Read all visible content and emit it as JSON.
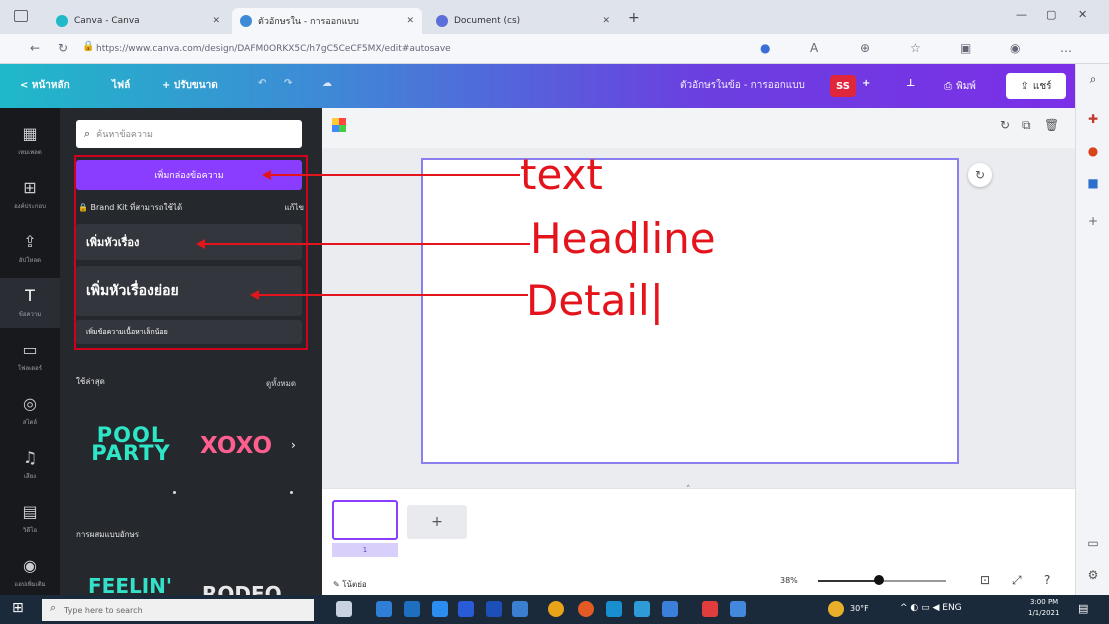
{
  "browser": {
    "tabs": [
      {
        "label": "Canva - Canva",
        "active": false
      },
      {
        "label": "ตัวอักษรใน - การออกแบบ",
        "active": true
      },
      {
        "label": "Document (cs)",
        "active": false
      }
    ],
    "new_tab": "+",
    "url": "https://www.canva.com/design/DAFM0ORKX5C/h7gC5CeCF5MX/edit#autosave"
  },
  "topbar": {
    "home": "< หน้าหลัก",
    "file": "ไฟล์",
    "resize": "+ ปรับขนาด",
    "design_title": "ตัวอักษรในข้อ - การออกแบบ",
    "avatar": "SS",
    "print": "พิมพ์",
    "share": "แชร์"
  },
  "rail": [
    {
      "icon": "▦",
      "label": "เทมเพลต"
    },
    {
      "icon": "⊞",
      "label": "องค์ประกอบ"
    },
    {
      "icon": "⇪",
      "label": "อัปโหลด"
    },
    {
      "icon": "T",
      "label": "ข้อความ"
    },
    {
      "icon": "▭",
      "label": "โฟลเดอร์"
    },
    {
      "icon": "◎",
      "label": "สไตล์"
    },
    {
      "icon": "♫",
      "label": "เสียง"
    },
    {
      "icon": "▤",
      "label": "วิดีโอ"
    },
    {
      "icon": "◉",
      "label": "แอปเพิ่มเติม"
    }
  ],
  "panel": {
    "search_placeholder": "ค้นหาข้อความ",
    "add_textbox": "เพิ่มกล่องข้อความ",
    "brand_kit": "Brand Kit ที่สามารถใช้ได้",
    "brand_edit": "แก้ไข",
    "heading": "เพิ่มหัวเรื่อง",
    "subheading": "เพิ่มหัวเรื่องย่อย",
    "body": "เพิ่มข้อความเนื้อหาเล็กน้อย",
    "section1": "ใช้ล่าสุด",
    "section1_link": "ดูทั้งหมด",
    "section2": "การผสมแบบอักษร",
    "sample1": "POOL PARTY",
    "sample2": "XOXO",
    "sample3": "FEELIN'",
    "sample4": "RODEO"
  },
  "annotations": {
    "text": "text",
    "headline": "Headline",
    "detail": "Detail|"
  },
  "footer": {
    "notes": "โน้ตย่อ",
    "zoom": "38%",
    "zoom_fraction": 0.38,
    "page_number": "1"
  },
  "taskbar": {
    "search": "Type here to search",
    "time": "3:00 PM",
    "date": "1/1/2021",
    "temp": "30°F"
  },
  "colors": {
    "accent": "#8b3dff",
    "annotation": "#e3141b",
    "panel": "#25282d",
    "rail": "#17191c"
  }
}
